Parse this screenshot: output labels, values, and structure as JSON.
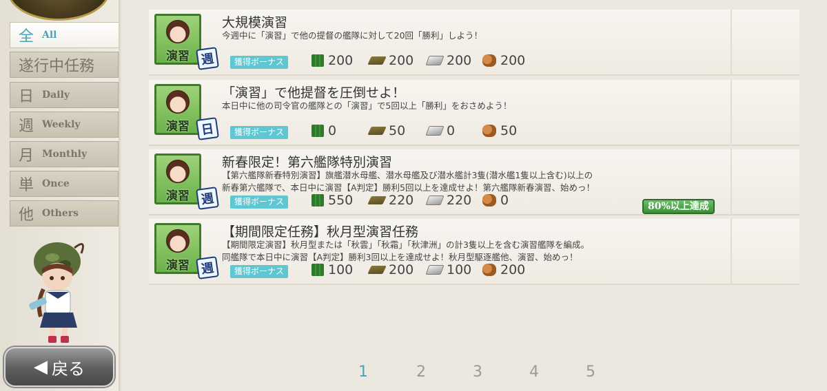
{
  "sidebar": {
    "categories": [
      {
        "kanji": "全",
        "label": "All",
        "active": true
      },
      {
        "label": "遂行中任務"
      },
      {
        "kanji": "日",
        "label": "Daily"
      },
      {
        "kanji": "週",
        "label": "Weekly"
      },
      {
        "kanji": "月",
        "label": "Monthly"
      },
      {
        "kanji": "単",
        "label": "Once"
      },
      {
        "kanji": "他",
        "label": "Others"
      }
    ],
    "back_label": "戻る"
  },
  "quests": [
    {
      "badge": "演習",
      "period": "週",
      "title": "大規模演習",
      "desc": [
        "今週中に「演習」で他の提督の艦隊に対して20回「勝利」しよう！"
      ],
      "bonus": "獲得ボーナス",
      "rewards": {
        "fuel": "200",
        "ammo": "200",
        "steel": "200",
        "bauxite": "200"
      }
    },
    {
      "badge": "演習",
      "period": "日",
      "title": "「演習」で他提督を圧倒せよ！",
      "desc": [
        "本日中に他の司令官の艦隊との「演習」で5回以上「勝利」をおさめよう！"
      ],
      "bonus": "獲得ボーナス",
      "rewards": {
        "fuel": "0",
        "ammo": "50",
        "steel": "0",
        "bauxite": "50"
      }
    },
    {
      "badge": "演習",
      "period": "週",
      "title": "新春限定！第六艦隊特別演習",
      "desc": [
        "【第六艦隊新春特別演習】旗艦潜水母艦、潜水母艦及び潜水艦計3隻(潜水艦1隻以上含む)以上の",
        "新春第六艦隊で、本日中に演習【A判定】勝利5回以上を達成せよ！第六艦隊新春演習、始めっ！"
      ],
      "bonus": "獲得ボーナス",
      "rewards": {
        "fuel": "550",
        "ammo": "220",
        "steel": "220",
        "bauxite": "0"
      },
      "progress": "80%以上達成"
    },
    {
      "badge": "演習",
      "period": "週",
      "title": "【期間限定任務】秋月型演習任務",
      "desc": [
        "【期間限定演習】秋月型または「秋雲」「秋霜」「秋津洲」の計3隻以上を含む演習艦隊を編成。",
        "同艦隊で本日中に演習【A判定】勝利3回以上を達成せよ！秋月型駆逐艦他、演習、始めっ！"
      ],
      "bonus": "獲得ボーナス",
      "rewards": {
        "fuel": "100",
        "ammo": "200",
        "steel": "100",
        "bauxite": "200"
      }
    }
  ],
  "pagination": {
    "pages": [
      "1",
      "2",
      "3",
      "4",
      "5"
    ],
    "current": "1"
  },
  "colors": {
    "accent": "#46a7bd",
    "badge_green": "#6ab24a",
    "bonus_teal": "#5fc6d2"
  }
}
